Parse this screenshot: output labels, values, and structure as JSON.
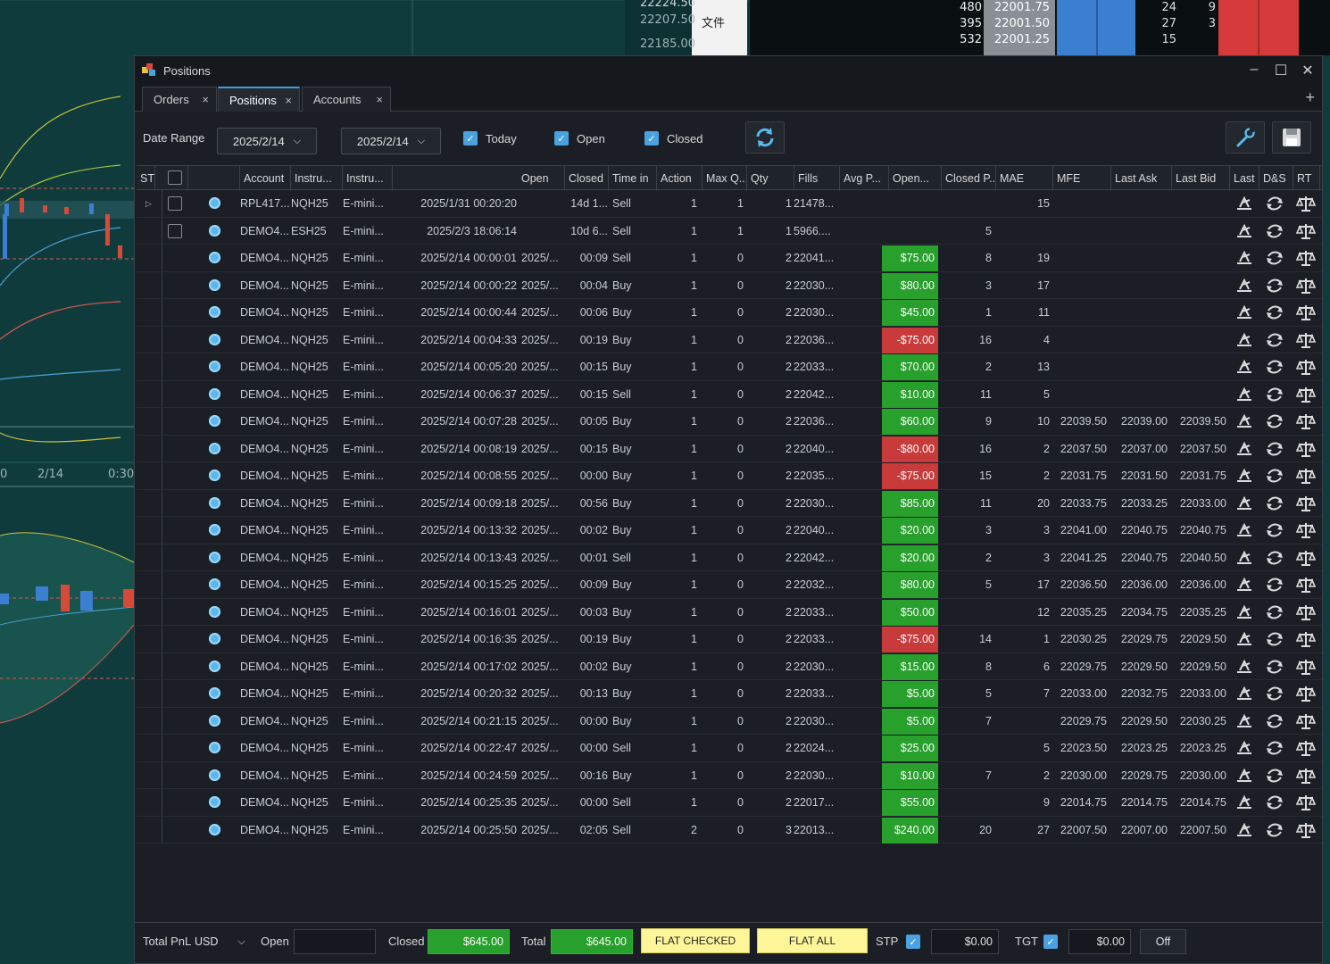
{
  "background": {
    "chart_ticks_top": [
      "22224.50",
      "22207.50",
      "22185.00"
    ],
    "menu_text": "文件",
    "chart_axis": [
      "0",
      "2/14",
      "0:30"
    ],
    "dom_rows": [
      {
        "qty": "480",
        "price": "22001.75",
        "a": "24",
        "b": "9"
      },
      {
        "qty": "395",
        "price": "22001.50",
        "a": "27",
        "b": "3"
      },
      {
        "qty": "532",
        "price": "22001.25",
        "a": "15",
        "b": ""
      }
    ]
  },
  "window": {
    "title": "Positions",
    "tabs": [
      {
        "label": "Orders"
      },
      {
        "label": "Positions"
      },
      {
        "label": "Accounts"
      }
    ],
    "close_glyph": "×",
    "add_glyph": "+"
  },
  "toolbar": {
    "date_range_label": "Date Range",
    "date_from": "2025/2/14",
    "date_to": "2025/2/14",
    "today_label": "Today",
    "open_label": "Open",
    "closed_label": "Closed",
    "refresh_icon": "refresh-icon",
    "settings_icon": "wrench-icon",
    "save_icon": "save-icon"
  },
  "columns": [
    "Account",
    "Instru...",
    "Instru...",
    "Open",
    "Closed",
    "Time in",
    "Action",
    "Max Q...",
    "Qty",
    "Fills",
    "Avg P...",
    "Open...",
    "Closed P...",
    "MAE",
    "MFE",
    "Last Ask",
    "Last Bid",
    "Last Price",
    "D&S",
    "RT",
    "ST"
  ],
  "rows": [
    {
      "expand": true,
      "check": true,
      "account": "RPL417...",
      "sym": "NQH25",
      "inst": "E-mini...",
      "open": "2025/1/31 00:20:20",
      "closed": "",
      "time": "14d 1...",
      "action": "Sell",
      "maxq": "1",
      "qty": "1",
      "fills": "1",
      "avg": "21478...",
      "openp": "",
      "pnl": "",
      "mae": "",
      "mfe": "15",
      "ask": "",
      "bid": "",
      "last": ""
    },
    {
      "expand": false,
      "check": true,
      "account": "DEMO4...",
      "sym": "ESH25",
      "inst": "E-mini...",
      "open": "2025/2/3 18:06:14",
      "closed": "",
      "time": "10d 6...",
      "action": "Sell",
      "maxq": "1",
      "qty": "1",
      "fills": "1",
      "avg": "5966....",
      "openp": "",
      "pnl": "",
      "mae": "5",
      "mfe": "",
      "ask": "",
      "bid": "",
      "last": ""
    },
    {
      "account": "DEMO4...",
      "sym": "NQH25",
      "inst": "E-mini...",
      "open": "2025/2/14 00:00:01",
      "closed": "2025/...",
      "time": "00:09",
      "action": "Sell",
      "maxq": "1",
      "qty": "0",
      "fills": "2",
      "avg": "22041...",
      "pnl": "$75.00",
      "mae": "8",
      "mfe": "19",
      "ask": "",
      "bid": "",
      "last": ""
    },
    {
      "account": "DEMO4...",
      "sym": "NQH25",
      "inst": "E-mini...",
      "open": "2025/2/14 00:00:22",
      "closed": "2025/...",
      "time": "00:04",
      "action": "Buy",
      "maxq": "1",
      "qty": "0",
      "fills": "2",
      "avg": "22030...",
      "pnl": "$80.00",
      "mae": "3",
      "mfe": "17",
      "ask": "",
      "bid": "",
      "last": ""
    },
    {
      "account": "DEMO4...",
      "sym": "NQH25",
      "inst": "E-mini...",
      "open": "2025/2/14 00:00:44",
      "closed": "2025/...",
      "time": "00:06",
      "action": "Buy",
      "maxq": "1",
      "qty": "0",
      "fills": "2",
      "avg": "22030...",
      "pnl": "$45.00",
      "mae": "1",
      "mfe": "11",
      "ask": "",
      "bid": "",
      "last": ""
    },
    {
      "account": "DEMO4...",
      "sym": "NQH25",
      "inst": "E-mini...",
      "open": "2025/2/14 00:04:33",
      "closed": "2025/...",
      "time": "00:19",
      "action": "Buy",
      "maxq": "1",
      "qty": "0",
      "fills": "2",
      "avg": "22036...",
      "pnl": "-$75.00",
      "mae": "16",
      "mfe": "4",
      "ask": "",
      "bid": "",
      "last": ""
    },
    {
      "account": "DEMO4...",
      "sym": "NQH25",
      "inst": "E-mini...",
      "open": "2025/2/14 00:05:20",
      "closed": "2025/...",
      "time": "00:15",
      "action": "Buy",
      "maxq": "1",
      "qty": "0",
      "fills": "2",
      "avg": "22033...",
      "pnl": "$70.00",
      "mae": "2",
      "mfe": "13",
      "ask": "",
      "bid": "",
      "last": ""
    },
    {
      "account": "DEMO4...",
      "sym": "NQH25",
      "inst": "E-mini...",
      "open": "2025/2/14 00:06:37",
      "closed": "2025/...",
      "time": "00:15",
      "action": "Sell",
      "maxq": "1",
      "qty": "0",
      "fills": "2",
      "avg": "22042...",
      "pnl": "$10.00",
      "mae": "11",
      "mfe": "5",
      "ask": "",
      "bid": "",
      "last": ""
    },
    {
      "account": "DEMO4...",
      "sym": "NQH25",
      "inst": "E-mini...",
      "open": "2025/2/14 00:07:28",
      "closed": "2025/...",
      "time": "00:05",
      "action": "Buy",
      "maxq": "1",
      "qty": "0",
      "fills": "2",
      "avg": "22036...",
      "pnl": "$60.00",
      "mae": "9",
      "mfe": "10",
      "ask": "22039.50",
      "bid": "22039.00",
      "last": "22039.50"
    },
    {
      "account": "DEMO4...",
      "sym": "NQH25",
      "inst": "E-mini...",
      "open": "2025/2/14 00:08:19",
      "closed": "2025/...",
      "time": "00:15",
      "action": "Buy",
      "maxq": "1",
      "qty": "0",
      "fills": "2",
      "avg": "22040...",
      "pnl": "-$80.00",
      "mae": "16",
      "mfe": "2",
      "ask": "22037.50",
      "bid": "22037.00",
      "last": "22037.50"
    },
    {
      "account": "DEMO4...",
      "sym": "NQH25",
      "inst": "E-mini...",
      "open": "2025/2/14 00:08:55",
      "closed": "2025/...",
      "time": "00:00",
      "action": "Buy",
      "maxq": "1",
      "qty": "0",
      "fills": "2",
      "avg": "22035...",
      "pnl": "-$75.00",
      "mae": "15",
      "mfe": "2",
      "ask": "22031.75",
      "bid": "22031.50",
      "last": "22031.75"
    },
    {
      "account": "DEMO4...",
      "sym": "NQH25",
      "inst": "E-mini...",
      "open": "2025/2/14 00:09:18",
      "closed": "2025/...",
      "time": "00:56",
      "action": "Buy",
      "maxq": "1",
      "qty": "0",
      "fills": "2",
      "avg": "22030...",
      "pnl": "$85.00",
      "mae": "11",
      "mfe": "20",
      "ask": "22033.75",
      "bid": "22033.25",
      "last": "22033.00"
    },
    {
      "account": "DEMO4...",
      "sym": "NQH25",
      "inst": "E-mini...",
      "open": "2025/2/14 00:13:32",
      "closed": "2025/...",
      "time": "00:02",
      "action": "Buy",
      "maxq": "1",
      "qty": "0",
      "fills": "2",
      "avg": "22040...",
      "pnl": "$20.00",
      "mae": "3",
      "mfe": "3",
      "ask": "22041.00",
      "bid": "22040.75",
      "last": "22040.75"
    },
    {
      "account": "DEMO4...",
      "sym": "NQH25",
      "inst": "E-mini...",
      "open": "2025/2/14 00:13:43",
      "closed": "2025/...",
      "time": "00:01",
      "action": "Sell",
      "maxq": "1",
      "qty": "0",
      "fills": "2",
      "avg": "22042...",
      "pnl": "$20.00",
      "mae": "2",
      "mfe": "3",
      "ask": "22041.25",
      "bid": "22040.75",
      "last": "22040.50"
    },
    {
      "account": "DEMO4...",
      "sym": "NQH25",
      "inst": "E-mini...",
      "open": "2025/2/14 00:15:25",
      "closed": "2025/...",
      "time": "00:09",
      "action": "Buy",
      "maxq": "1",
      "qty": "0",
      "fills": "2",
      "avg": "22032...",
      "pnl": "$80.00",
      "mae": "5",
      "mfe": "17",
      "ask": "22036.50",
      "bid": "22036.00",
      "last": "22036.00"
    },
    {
      "account": "DEMO4...",
      "sym": "NQH25",
      "inst": "E-mini...",
      "open": "2025/2/14 00:16:01",
      "closed": "2025/...",
      "time": "00:03",
      "action": "Buy",
      "maxq": "1",
      "qty": "0",
      "fills": "2",
      "avg": "22033...",
      "pnl": "$50.00",
      "mae": "",
      "mfe": "12",
      "ask": "22035.25",
      "bid": "22034.75",
      "last": "22035.25"
    },
    {
      "account": "DEMO4...",
      "sym": "NQH25",
      "inst": "E-mini...",
      "open": "2025/2/14 00:16:35",
      "closed": "2025/...",
      "time": "00:19",
      "action": "Buy",
      "maxq": "1",
      "qty": "0",
      "fills": "2",
      "avg": "22033...",
      "pnl": "-$75.00",
      "mae": "14",
      "mfe": "1",
      "ask": "22030.25",
      "bid": "22029.75",
      "last": "22029.50"
    },
    {
      "account": "DEMO4...",
      "sym": "NQH25",
      "inst": "E-mini...",
      "open": "2025/2/14 00:17:02",
      "closed": "2025/...",
      "time": "00:02",
      "action": "Buy",
      "maxq": "1",
      "qty": "0",
      "fills": "2",
      "avg": "22030...",
      "pnl": "$15.00",
      "mae": "8",
      "mfe": "6",
      "ask": "22029.75",
      "bid": "22029.50",
      "last": "22029.50"
    },
    {
      "account": "DEMO4...",
      "sym": "NQH25",
      "inst": "E-mini...",
      "open": "2025/2/14 00:20:32",
      "closed": "2025/...",
      "time": "00:13",
      "action": "Buy",
      "maxq": "1",
      "qty": "0",
      "fills": "2",
      "avg": "22033...",
      "pnl": "$5.00",
      "mae": "5",
      "mfe": "7",
      "ask": "22033.00",
      "bid": "22032.75",
      "last": "22033.00"
    },
    {
      "account": "DEMO4...",
      "sym": "NQH25",
      "inst": "E-mini...",
      "open": "2025/2/14 00:21:15",
      "closed": "2025/...",
      "time": "00:00",
      "action": "Buy",
      "maxq": "1",
      "qty": "0",
      "fills": "2",
      "avg": "22030...",
      "pnl": "$5.00",
      "mae": "7",
      "mfe": "",
      "ask": "22029.75",
      "bid": "22029.50",
      "last": "22030.25"
    },
    {
      "account": "DEMO4...",
      "sym": "NQH25",
      "inst": "E-mini...",
      "open": "2025/2/14 00:22:47",
      "closed": "2025/...",
      "time": "00:00",
      "action": "Sell",
      "maxq": "1",
      "qty": "0",
      "fills": "2",
      "avg": "22024...",
      "pnl": "$25.00",
      "mae": "",
      "mfe": "5",
      "ask": "22023.50",
      "bid": "22023.25",
      "last": "22023.25"
    },
    {
      "account": "DEMO4...",
      "sym": "NQH25",
      "inst": "E-mini...",
      "open": "2025/2/14 00:24:59",
      "closed": "2025/...",
      "time": "00:16",
      "action": "Buy",
      "maxq": "1",
      "qty": "0",
      "fills": "2",
      "avg": "22030...",
      "pnl": "$10.00",
      "mae": "7",
      "mfe": "2",
      "ask": "22030.00",
      "bid": "22029.75",
      "last": "22030.00"
    },
    {
      "account": "DEMO4...",
      "sym": "NQH25",
      "inst": "E-mini...",
      "open": "2025/2/14 00:25:35",
      "closed": "2025/...",
      "time": "00:00",
      "action": "Sell",
      "maxq": "1",
      "qty": "0",
      "fills": "2",
      "avg": "22017...",
      "pnl": "$55.00",
      "mae": "",
      "mfe": "9",
      "ask": "22014.75",
      "bid": "22014.75",
      "last": "22014.75"
    },
    {
      "account": "DEMO4...",
      "sym": "NQH25",
      "inst": "E-mini...",
      "open": "2025/2/14 00:25:50",
      "closed": "2025/...",
      "time": "02:05",
      "action": "Sell",
      "maxq": "2",
      "qty": "0",
      "fills": "3",
      "avg": "22013...",
      "pnl": "$240.00",
      "mae": "20",
      "mfe": "27",
      "ask": "22007.50",
      "bid": "22007.00",
      "last": "22007.50"
    }
  ],
  "footer": {
    "total_pnl_label": "Total PnL",
    "currency": "USD",
    "open_label": "Open",
    "open_value": "",
    "closed_label": "Closed",
    "closed_value": "$645.00",
    "total_label": "Total",
    "total_value": "$645.00",
    "flat_checked": "FLAT CHECKED",
    "flat_all": "FLAT ALL",
    "stp_label": "STP",
    "stp_value": "$0.00",
    "tgt_label": "TGT",
    "tgt_value": "$0.00",
    "off_label": "Off"
  },
  "colors": {
    "profit": "#27a02c",
    "loss": "#c93a3a",
    "accent": "#4aa3e0",
    "flat_button": "#fff69a"
  }
}
